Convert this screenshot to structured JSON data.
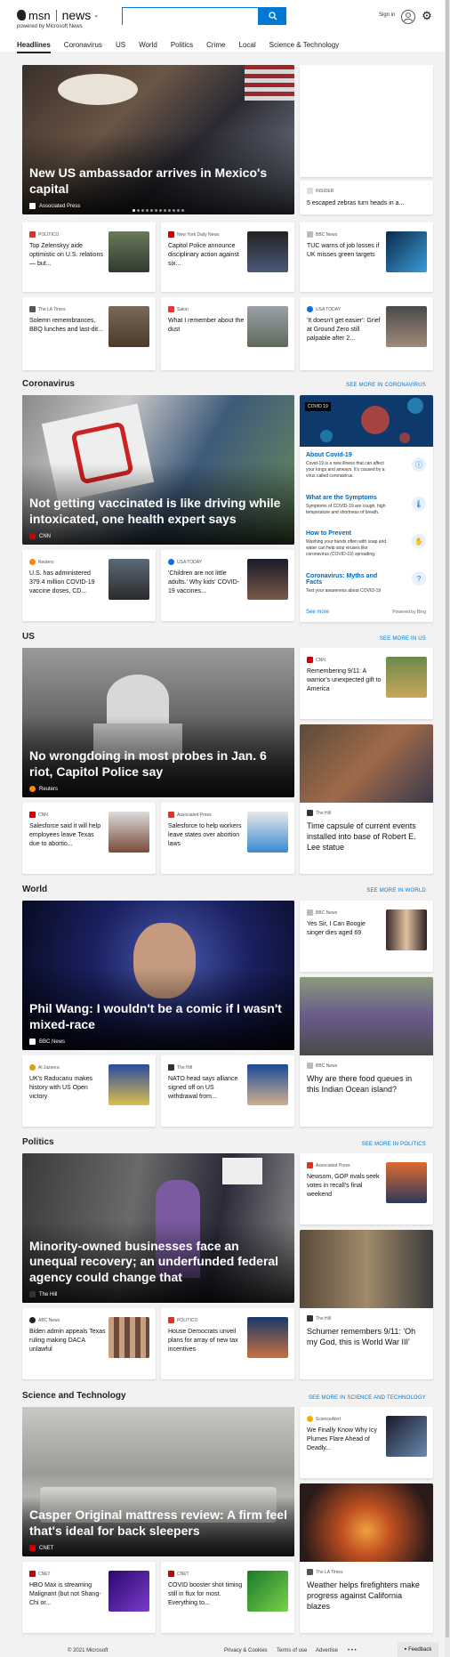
{
  "header": {
    "brand": "msn",
    "product": "news",
    "powered_by": "powered by Microsoft News",
    "search_placeholder": "",
    "signin": "Sign in",
    "icons": [
      "search-icon",
      "avatar-icon",
      "gear-icon"
    ]
  },
  "nav": [
    "Headlines",
    "Coronavirus",
    "US",
    "World",
    "Politics",
    "Crime",
    "Local",
    "Science & Technology"
  ],
  "headlines": {
    "hero": {
      "title": "New US ambassador arrives in Mexico's capital",
      "source": "Associated Press",
      "slides": 12,
      "active_slide": 1
    },
    "side_card": {
      "source": "INSIDER",
      "headline": "5 escaped zebras turn heads in a..."
    },
    "cards": [
      {
        "source": "POLITICO",
        "headline": "Top Zelenskyy aide optimistic on U.S. relations — but..."
      },
      {
        "source": "New York Daily News",
        "headline": "Capitol Police announce disciplinary action against six..."
      },
      {
        "source": "BBC News",
        "headline": "TUC warns of job losses if UK misses green targets"
      },
      {
        "source": "The LA Times",
        "headline": "Solemn remembrances, BBQ lunches and last-dit..."
      },
      {
        "source": "Salon",
        "headline": "What I remember about the dust"
      },
      {
        "source": "USA TODAY",
        "headline": "'It doesn't get easier': Grief at Ground Zero still palpable after 2..."
      }
    ]
  },
  "coronavirus": {
    "title": "Coronavirus",
    "see_more": "SEE MORE IN CORONAVIRUS",
    "hero": {
      "title": "Not getting vaccinated is like driving while intoxicated, one health expert says",
      "source": "CNN"
    },
    "cards": [
      {
        "source": "Reuters",
        "headline": "U.S. has administered 379.4 million COVID-19 vaccine doses, CD..."
      },
      {
        "source": "USA TODAY",
        "headline": "'Children are not little adults.' Why kids' COVID-19 vaccines..."
      }
    ],
    "panel": {
      "badge": "COVID 19",
      "items": [
        {
          "title": "About Covid-19",
          "text": "Covid-19 is a new illness that can affect your lungs and airways. It's caused by a virus called coronavirus."
        },
        {
          "title": "What are the Symptoms",
          "text": "Symptoms of COVID-19 are cough, high temperature and shortness of breath."
        },
        {
          "title": "How to Prevent",
          "text": "Washing your hands often with soap and water can help stop viruses like coronavirus (COVID-19) spreading."
        },
        {
          "title": "Coronavirus: Myths and Facts",
          "text": "Test your awareness about COVID-19"
        }
      ],
      "see_more": "See more",
      "powered": "Powered by Bing"
    }
  },
  "us": {
    "title": "US",
    "see_more": "SEE MORE IN US",
    "hero": {
      "title": "No wrongdoing in most probes in Jan. 6 riot, Capitol Police say",
      "source": "Reuters"
    },
    "side_card": {
      "source": "CNN",
      "headline": "Remembering 9/11: A warrior's unexpected gift to America"
    },
    "tall_card": {
      "source": "The Hill",
      "headline": "Time capsule of current events installed into base of Robert E. Lee statue"
    },
    "cards": [
      {
        "source": "CNN",
        "headline": "Salesforce said it will help employees leave Texas due to abortio..."
      },
      {
        "source": "Associated Press",
        "headline": "Salesforce to help workers leave states over abortion laws"
      }
    ]
  },
  "world": {
    "title": "World",
    "see_more": "SEE MORE IN WORLD",
    "hero": {
      "title": "Phil Wang: I wouldn't be a comic if I wasn't mixed-race",
      "source": "BBC News"
    },
    "side_card": {
      "source": "BBC News",
      "headline": "Yes Sir, I Can Boogie singer dies aged 69"
    },
    "tall_card": {
      "source": "BBC News",
      "headline": "Why are there food queues in this Indian Ocean island?"
    },
    "cards": [
      {
        "source": "Al Jazeera",
        "headline": "UK's Raducanu makes history with US Open victory"
      },
      {
        "source": "The Hill",
        "headline": "NATO head says alliance signed off on US withdrawal from..."
      }
    ]
  },
  "politics": {
    "title": "Politics",
    "see_more": "SEE MORE IN POLITICS",
    "hero": {
      "title": "Minority-owned businesses face an unequal recovery; an underfunded federal agency could change that",
      "source": "The Hill"
    },
    "side_card": {
      "source": "Associated Press",
      "headline": "Newsom, GOP rivals seek votes in recall's final weekend"
    },
    "tall_card": {
      "source": "The Hill",
      "headline": "Schumer remembers 9/11: 'Oh my God, this is World War III'"
    },
    "cards": [
      {
        "source": "ABC News",
        "headline": "Biden admin appeals Texas ruling making DACA unlawful"
      },
      {
        "source": "POLITICO",
        "headline": "House Democrats unveil plans for array of new tax incentives"
      }
    ]
  },
  "science": {
    "title": "Science and Technology",
    "see_more": "SEE MORE IN SCIENCE AND TECHNOLOGY",
    "hero": {
      "title": "Casper Original mattress review: A firm feel that's ideal for back sleepers",
      "source": "CNET"
    },
    "side_card": {
      "source": "ScienceAlert",
      "headline": "We Finally Know Why Icy Plumes Flare Ahead of Deadly..."
    },
    "tall_card": {
      "source": "The LA Times",
      "headline": "Weather helps firefighters make progress against California blazes"
    },
    "cards": [
      {
        "source": "CNET",
        "headline": "HBO Max is streaming Malignant (but not Shang-Chi or..."
      },
      {
        "source": "CNET",
        "headline": "COVID booster shot timing still in flux for most. Everything to..."
      }
    ]
  },
  "footer": {
    "copyright": "© 2021 Microsoft",
    "links": [
      "Privacy & Cookies",
      "Terms of use",
      "Advertise"
    ],
    "more": "• • •",
    "feedback": "Feedback"
  },
  "colors": {
    "accent": "#0078d4",
    "background": "#f2f2f2"
  }
}
